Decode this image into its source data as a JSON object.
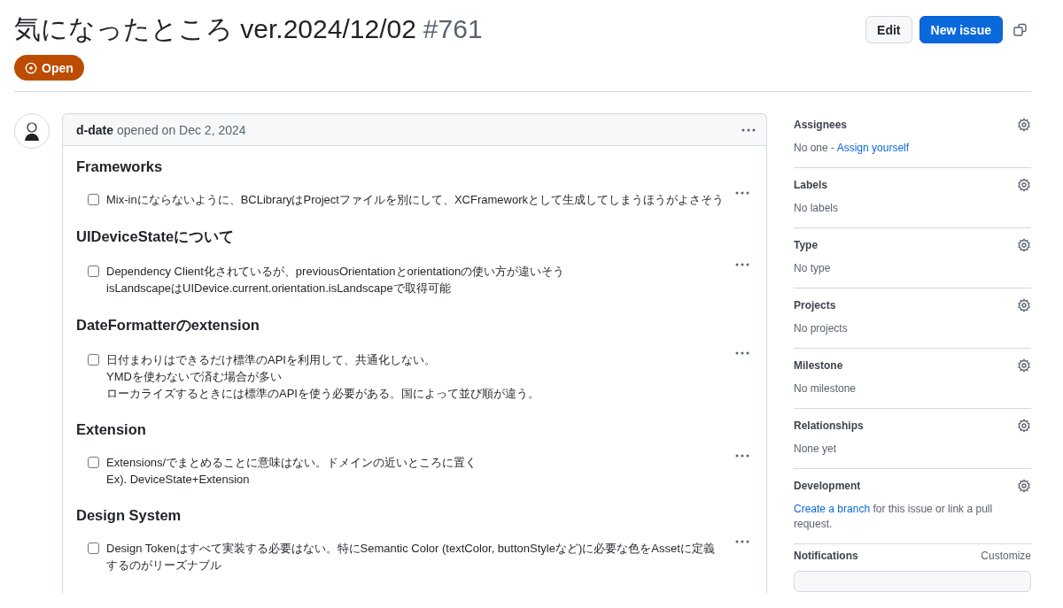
{
  "issue": {
    "title": "気になったところ ver.2024/12/02",
    "number": "#761",
    "state": "Open"
  },
  "actions": [
    "Edit",
    "New issue"
  ],
  "comment": {
    "author": "d-date",
    "meta": "opened on Dec 2, 2024",
    "sections": [
      {
        "heading": "Frameworks",
        "tasks": [
          {
            "checked": false,
            "lines": [
              "Mix-inにならないように、BCLibraryはProjectファイルを別にして、XCFrameworkとして生成してしまうほうがよさそう"
            ]
          }
        ]
      },
      {
        "heading": "UIDeviceStateについて",
        "tasks": [
          {
            "checked": false,
            "lines": [
              "Dependency Client化されているが、previousOrientationとorientationの使い方が違いそう",
              "isLandscapeはUIDevice.current.orientation.isLandscapeで取得可能"
            ]
          }
        ]
      },
      {
        "heading": "DateFormatterのextension",
        "tasks": [
          {
            "checked": false,
            "lines": [
              "日付まわりはできるだけ標準のAPIを利用して、共通化しない。",
              "YMDを使わないで済む場合が多い",
              "ローカライズするときには標準のAPIを使う必要がある。国によって並び順が違う。"
            ]
          }
        ]
      },
      {
        "heading": "Extension",
        "tasks": [
          {
            "checked": false,
            "lines": [
              "Extensions/でまとめることに意味はない。ドメインの近いところに置く",
              "Ex). DeviceState+Extension"
            ]
          }
        ]
      },
      {
        "heading": "Design System",
        "tasks": [
          {
            "checked": false,
            "lines": [
              "Design Tokenはすべて実装する必要はない。特にSemantic Color (textColor, buttonStyleなど)に必要な色をAssetに定義するのがリーズナブル"
            ]
          }
        ]
      }
    ]
  },
  "sidebar": [
    {
      "title": "Assignees",
      "body": [
        {
          "kind": "text",
          "text": "No one -"
        },
        {
          "kind": "link",
          "text": "Assign yourself"
        }
      ]
    },
    {
      "title": "Labels",
      "body": [
        {
          "kind": "text",
          "text": "No labels"
        }
      ]
    },
    {
      "title": "Type",
      "body": [
        {
          "kind": "text",
          "text": "No type"
        }
      ]
    },
    {
      "title": "Projects",
      "body": [
        {
          "kind": "text",
          "text": "No projects"
        }
      ]
    },
    {
      "title": "Milestone",
      "body": [
        {
          "kind": "text",
          "text": "No milestone"
        }
      ]
    },
    {
      "title": "Relationships",
      "body": [
        {
          "kind": "text",
          "text": "None yet"
        }
      ]
    },
    {
      "title": "Development",
      "body": [
        {
          "kind": "link",
          "text": "Create a branch"
        },
        {
          "kind": "text",
          "text": "for this issue or link a pull request."
        }
      ]
    }
  ],
  "notifications": {
    "title": "Notifications",
    "action": "Customize"
  }
}
